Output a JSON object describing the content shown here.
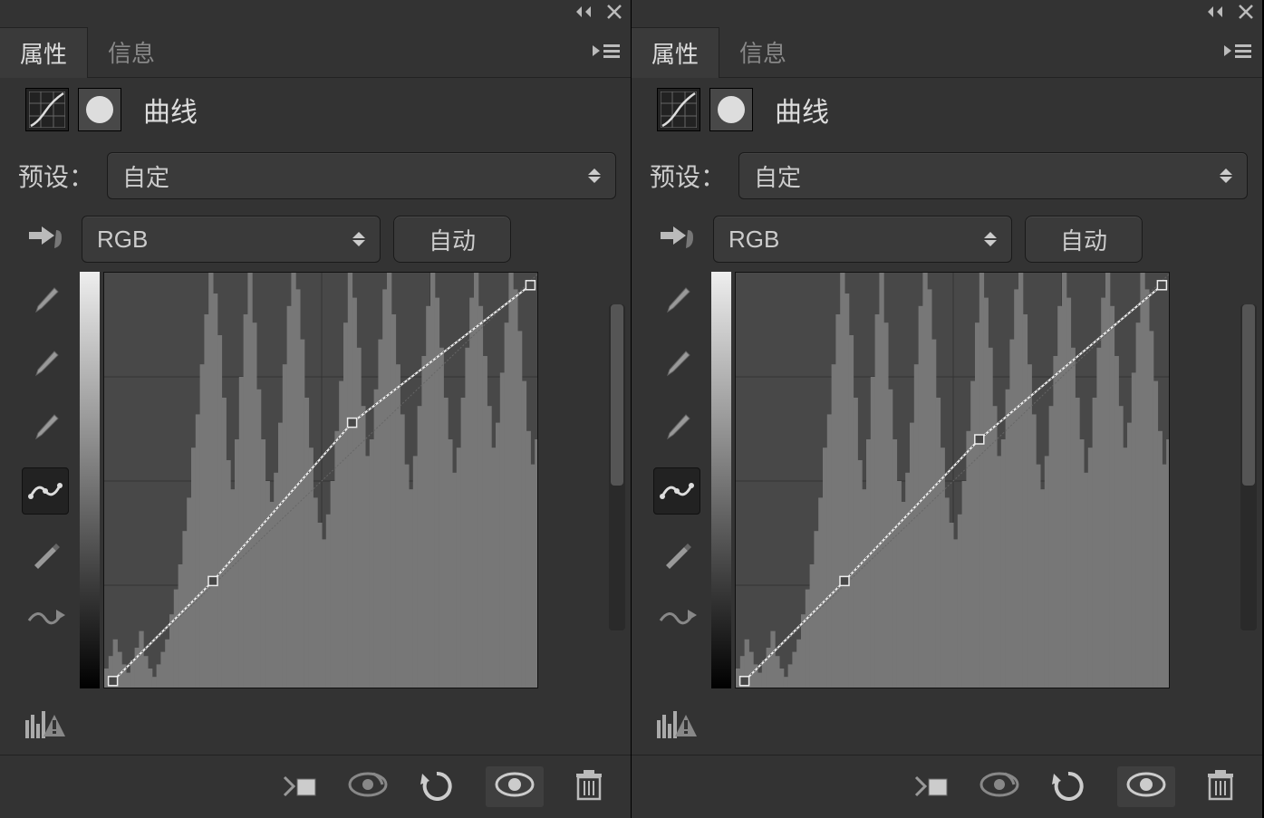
{
  "panels": [
    {
      "tabs": {
        "properties": "属性",
        "info": "信息"
      },
      "adjustment_title": "曲线",
      "preset_label": "预设：",
      "preset_value": "自定",
      "channel_value": "RGB",
      "auto_label": "自动",
      "curve": {
        "points": [
          {
            "x": 0.02,
            "y": 0.98
          },
          {
            "x": 0.25,
            "y": 0.74
          },
          {
            "x": 0.57,
            "y": 0.36
          },
          {
            "x": 0.98,
            "y": 0.03
          }
        ],
        "diagonal": true
      }
    },
    {
      "tabs": {
        "properties": "属性",
        "info": "信息"
      },
      "adjustment_title": "曲线",
      "preset_label": "预设：",
      "preset_value": "自定",
      "channel_value": "RGB",
      "auto_label": "自动",
      "curve": {
        "points": [
          {
            "x": 0.02,
            "y": 0.98
          },
          {
            "x": 0.25,
            "y": 0.74
          },
          {
            "x": 0.56,
            "y": 0.4
          },
          {
            "x": 0.98,
            "y": 0.03
          }
        ],
        "diagonal": true
      }
    }
  ],
  "histogram": [
    5,
    8,
    12,
    9,
    6,
    4,
    7,
    10,
    14,
    8,
    5,
    3,
    6,
    9,
    12,
    18,
    24,
    30,
    38,
    46,
    58,
    66,
    78,
    90,
    100,
    95,
    85,
    70,
    55,
    48,
    60,
    75,
    90,
    100,
    88,
    72,
    60,
    50,
    45,
    52,
    64,
    78,
    92,
    100,
    96,
    84,
    70,
    58,
    46,
    40,
    36,
    42,
    50,
    62,
    74,
    88,
    100,
    94,
    82,
    68,
    56,
    60,
    72,
    84,
    96,
    100,
    90,
    78,
    66,
    54,
    48,
    56,
    68,
    80,
    92,
    100,
    94,
    82,
    70,
    60,
    52,
    58,
    70,
    82,
    94,
    100,
    92,
    80,
    68,
    58,
    64,
    76,
    88,
    100,
    96,
    86,
    74,
    62,
    54,
    60
  ]
}
